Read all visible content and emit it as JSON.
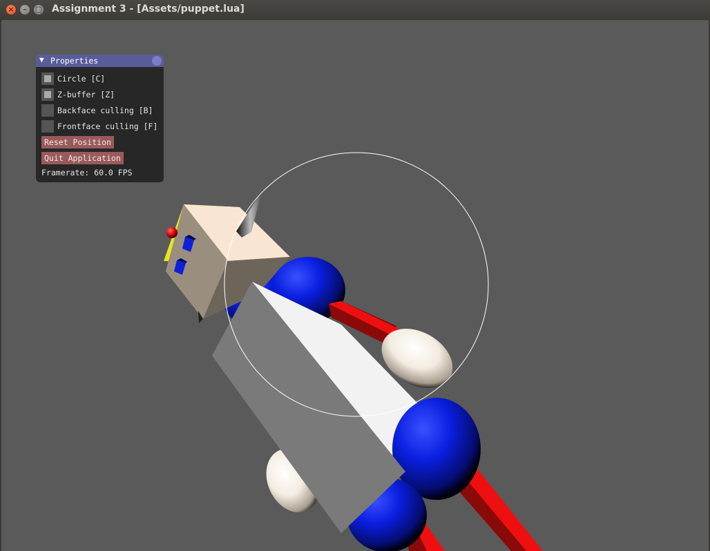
{
  "window": {
    "title": "Assignment 3 - [Assets/puppet.lua]",
    "close_glyph": "×",
    "minimize_glyph": "–",
    "maximize_glyph": "□"
  },
  "panel": {
    "arrow": "▼",
    "title": "Properties",
    "options": [
      {
        "label": "Circle [C]",
        "checked": true
      },
      {
        "label": "Z-buffer [Z]",
        "checked": true
      },
      {
        "label": "Backface culling [B]",
        "checked": false
      },
      {
        "label": "Frontface culling [F]",
        "checked": false
      }
    ],
    "reset_label": "Reset Position",
    "quit_label": "Quit Application",
    "framerate": "Framerate: 60.0 FPS"
  },
  "colors": {
    "viewport_bg": "#5a5a5a",
    "panel_header": "#5a5c9a",
    "button_bg": "#9a5a5a",
    "joint_blue": "#0a1fe0",
    "limb_red": "#ee1111",
    "head_yellow": "#e6e61e"
  }
}
